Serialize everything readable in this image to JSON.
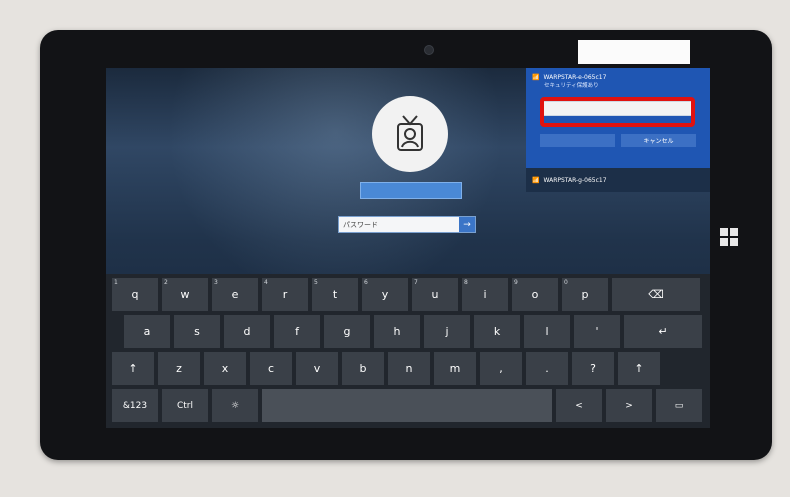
{
  "login": {
    "password_placeholder": "パスワード",
    "submit_glyph": "→"
  },
  "wifi": {
    "network1_name": "WARPSTAR-e-065c17",
    "network1_status": "セキュリティ保護あり",
    "ok_label": "",
    "cancel_label": "キャンセル",
    "network2_name": "WARPSTAR-g-065c17"
  },
  "keyboard": {
    "row1": [
      {
        "num": "1",
        "label": "q"
      },
      {
        "num": "2",
        "label": "w"
      },
      {
        "num": "3",
        "label": "e"
      },
      {
        "num": "4",
        "label": "r"
      },
      {
        "num": "5",
        "label": "t"
      },
      {
        "num": "6",
        "label": "y"
      },
      {
        "num": "7",
        "label": "u"
      },
      {
        "num": "8",
        "label": "i"
      },
      {
        "num": "9",
        "label": "o"
      },
      {
        "num": "0",
        "label": "p"
      },
      {
        "num": "",
        "label": "⌫"
      }
    ],
    "row2": [
      "a",
      "s",
      "d",
      "f",
      "g",
      "h",
      "j",
      "k",
      "l",
      "'",
      "↵"
    ],
    "row3": [
      "↑",
      "z",
      "x",
      "c",
      "v",
      "b",
      "n",
      "m",
      ",",
      ".",
      "?",
      "↑"
    ],
    "row4": [
      "&123",
      "Ctrl",
      "☼",
      "",
      "<",
      ">",
      "▭"
    ]
  }
}
